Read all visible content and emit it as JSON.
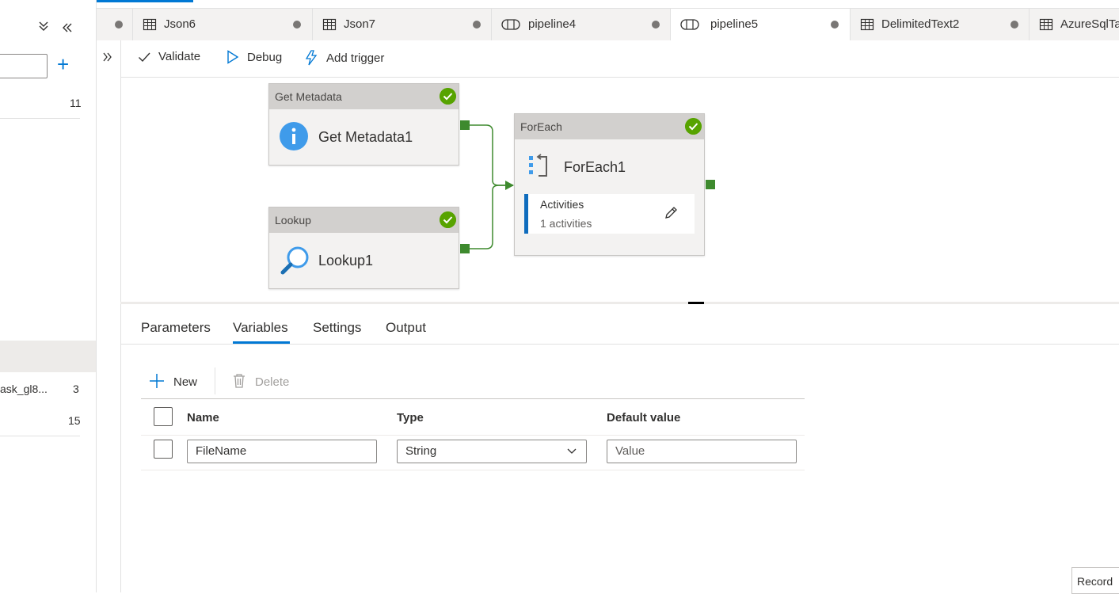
{
  "left_panel": {
    "count_1": "11",
    "truncated_item": "ask_gl8...",
    "count_2": "3",
    "count_3": "15",
    "add_symbol": "+"
  },
  "tabs": [
    {
      "label": "Json6",
      "icon": "table-icon"
    },
    {
      "label": "Json7",
      "icon": "table-icon"
    },
    {
      "label": "pipeline4",
      "icon": "pipeline-icon"
    },
    {
      "label": "pipeline5",
      "icon": "pipeline-icon",
      "active": true
    },
    {
      "label": "DelimitedText2",
      "icon": "table-icon"
    },
    {
      "label": "AzureSqlTa",
      "icon": "table-icon"
    }
  ],
  "toolbar": {
    "validate": "Validate",
    "debug": "Debug",
    "add_trigger": "Add trigger"
  },
  "activities": {
    "get_metadata": {
      "type": "Get Metadata",
      "name": "Get Metadata1",
      "status": "succeeded"
    },
    "lookup": {
      "type": "Lookup",
      "name": "Lookup1",
      "status": "succeeded"
    },
    "foreach": {
      "type": "ForEach",
      "name": "ForEach1",
      "status": "succeeded",
      "inner_title": "Activities",
      "inner_count": "1 activities"
    }
  },
  "bottom_tabs": {
    "parameters": "Parameters",
    "variables": "Variables",
    "settings": "Settings",
    "output": "Output",
    "active": "Variables"
  },
  "variables": {
    "new_label": "New",
    "delete_label": "Delete",
    "columns": {
      "name": "Name",
      "type": "Type",
      "default": "Default value"
    },
    "rows": [
      {
        "name": "FileName",
        "type": "String",
        "default_placeholder": "Value"
      }
    ]
  },
  "record_label": "Record",
  "colors": {
    "accent": "#0078d4",
    "success": "#57a300",
    "connector": "#3e8a2e"
  }
}
